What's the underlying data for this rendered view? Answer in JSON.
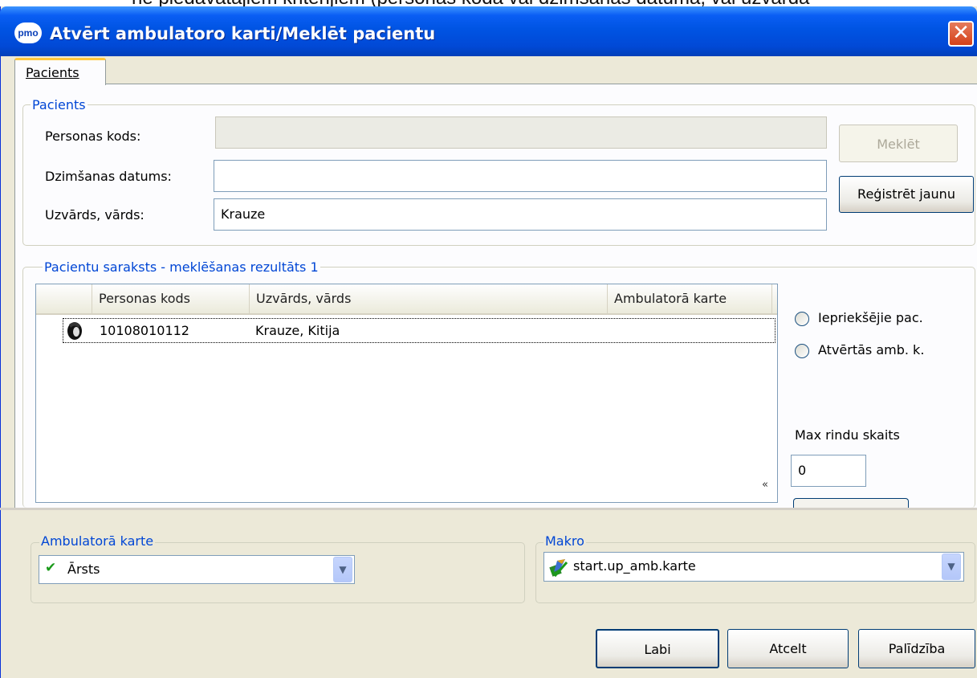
{
  "background_text": "ne piedāvātajiem kritērijiem (personas koda vai dzimšanas datuma, vai uzvārda",
  "window": {
    "app_icon_text": "pmo",
    "title": "Atvērt ambulatoro karti/Meklēt pacientu",
    "close_glyph": "✕"
  },
  "tabs": [
    {
      "label": "Pacients",
      "active": true
    }
  ],
  "patient_group": {
    "title": "Pacients",
    "personal_code": {
      "label": "Personas kods:",
      "value": ""
    },
    "birth_date": {
      "label": "Dzimšanas datums:",
      "value": ""
    },
    "name": {
      "label": "Uzvārds, vārds:",
      "value": "Krauze"
    },
    "search_button": "Meklēt",
    "register_button": "Reģistrēt jaunu"
  },
  "results_group": {
    "title": "Pacientu saraksts - meklēšanas rezultāts 1",
    "columns": [
      "Personas kods",
      "Uzvārds, vārds",
      "Ambulatorā karte"
    ],
    "rows": [
      {
        "icon": "patient-icon",
        "personal_code": "10108010112",
        "name": "Krauze, Kitija",
        "card": ""
      }
    ],
    "collapse_glyph": "«",
    "radio_previous": "Iepriekšējie pac.",
    "radio_opened": "Atvērtās amb. k.",
    "max_rows_label": "Max rindu skaits",
    "max_rows_value": "0"
  },
  "card_group": {
    "title": "Ambulatorā karte",
    "selected": "Ārsts",
    "icon": "checkmark-icon"
  },
  "macro_group": {
    "title": "Makro",
    "selected": "start.up_amb.karte",
    "icon": "macro-icon"
  },
  "buttons": {
    "ok": "Labi",
    "cancel": "Atcelt",
    "help": "Palīdzība"
  },
  "colors": {
    "group_title": "#0046d5",
    "title_bar": "#0054e3",
    "dialog_bg": "#ece9d8"
  }
}
